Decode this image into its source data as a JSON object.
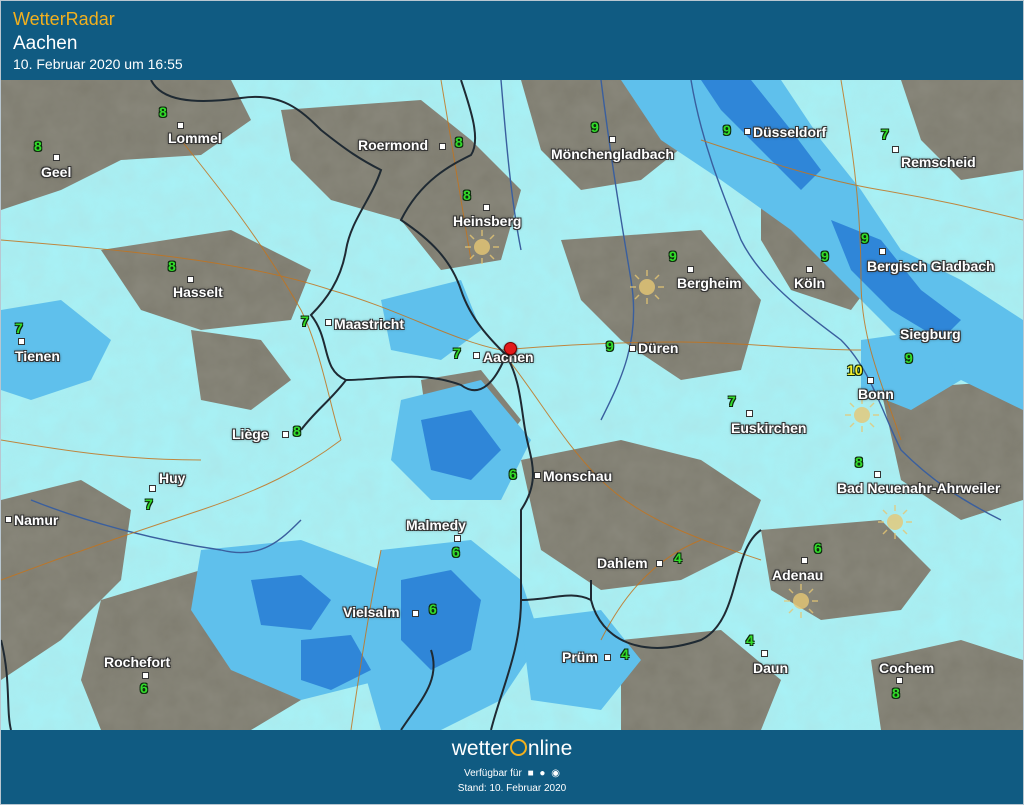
{
  "header": {
    "title": "WetterRadar",
    "city": "Aachen",
    "date": "10. Februar 2020 um 16:55"
  },
  "footer": {
    "brand_a": "wetter",
    "brand_b": "nline",
    "available": "Verfügbar für",
    "stand": "Stand: 10. Februar 2020"
  },
  "colors": {
    "header_bg": "#105b82",
    "accent": "#f2b01e",
    "rain_light": "#a7f3f8",
    "rain_medium": "#5fc0ec",
    "rain_heavy": "#2f86d8",
    "terrain": "#7e7c6f",
    "temperature": "#32dc2a",
    "temperature_warm": "#f6ef2c"
  },
  "icons": [
    "sun-icon",
    "location-pin-icon",
    "android-icon",
    "apple-icon",
    "windows-icon"
  ],
  "cities": [
    {
      "name": "Lommel",
      "temp": "8"
    },
    {
      "name": "Geel",
      "temp": "8"
    },
    {
      "name": "Roermond",
      "temp": "8"
    },
    {
      "name": "Mönchengladbach",
      "temp": "9"
    },
    {
      "name": "Düsseldorf",
      "temp": "9"
    },
    {
      "name": "Remscheid",
      "temp": "7"
    },
    {
      "name": "Heinsberg",
      "temp": "8"
    },
    {
      "name": "Bergisch Gladbach",
      "temp": "9"
    },
    {
      "name": "Hasselt",
      "temp": "8"
    },
    {
      "name": "Bergheim",
      "temp": "9"
    },
    {
      "name": "Köln",
      "temp": "9"
    },
    {
      "name": "Maastricht",
      "temp": "7"
    },
    {
      "name": "Tienen",
      "temp": "7"
    },
    {
      "name": "Aachen",
      "temp": "7"
    },
    {
      "name": "Düren",
      "temp": "9"
    },
    {
      "name": "Siegburg",
      "temp": "9"
    },
    {
      "name": "Bonn",
      "temp": "10"
    },
    {
      "name": "Liège",
      "temp": "8"
    },
    {
      "name": "Euskirchen",
      "temp": "7"
    },
    {
      "name": "Huy",
      "temp": "7"
    },
    {
      "name": "Monschau",
      "temp": "6"
    },
    {
      "name": "Bad Neuenahr-Ahrweiler",
      "temp": "8"
    },
    {
      "name": "Namur",
      "temp": ""
    },
    {
      "name": "Malmedy",
      "temp": "6"
    },
    {
      "name": "Dahlem",
      "temp": "4"
    },
    {
      "name": "Adenau",
      "temp": "6"
    },
    {
      "name": "Vielsalm",
      "temp": "6"
    },
    {
      "name": "Rochefort",
      "temp": "6"
    },
    {
      "name": "Prüm",
      "temp": "4"
    },
    {
      "name": "Daun",
      "temp": "4"
    },
    {
      "name": "Cochem",
      "temp": "8"
    }
  ]
}
